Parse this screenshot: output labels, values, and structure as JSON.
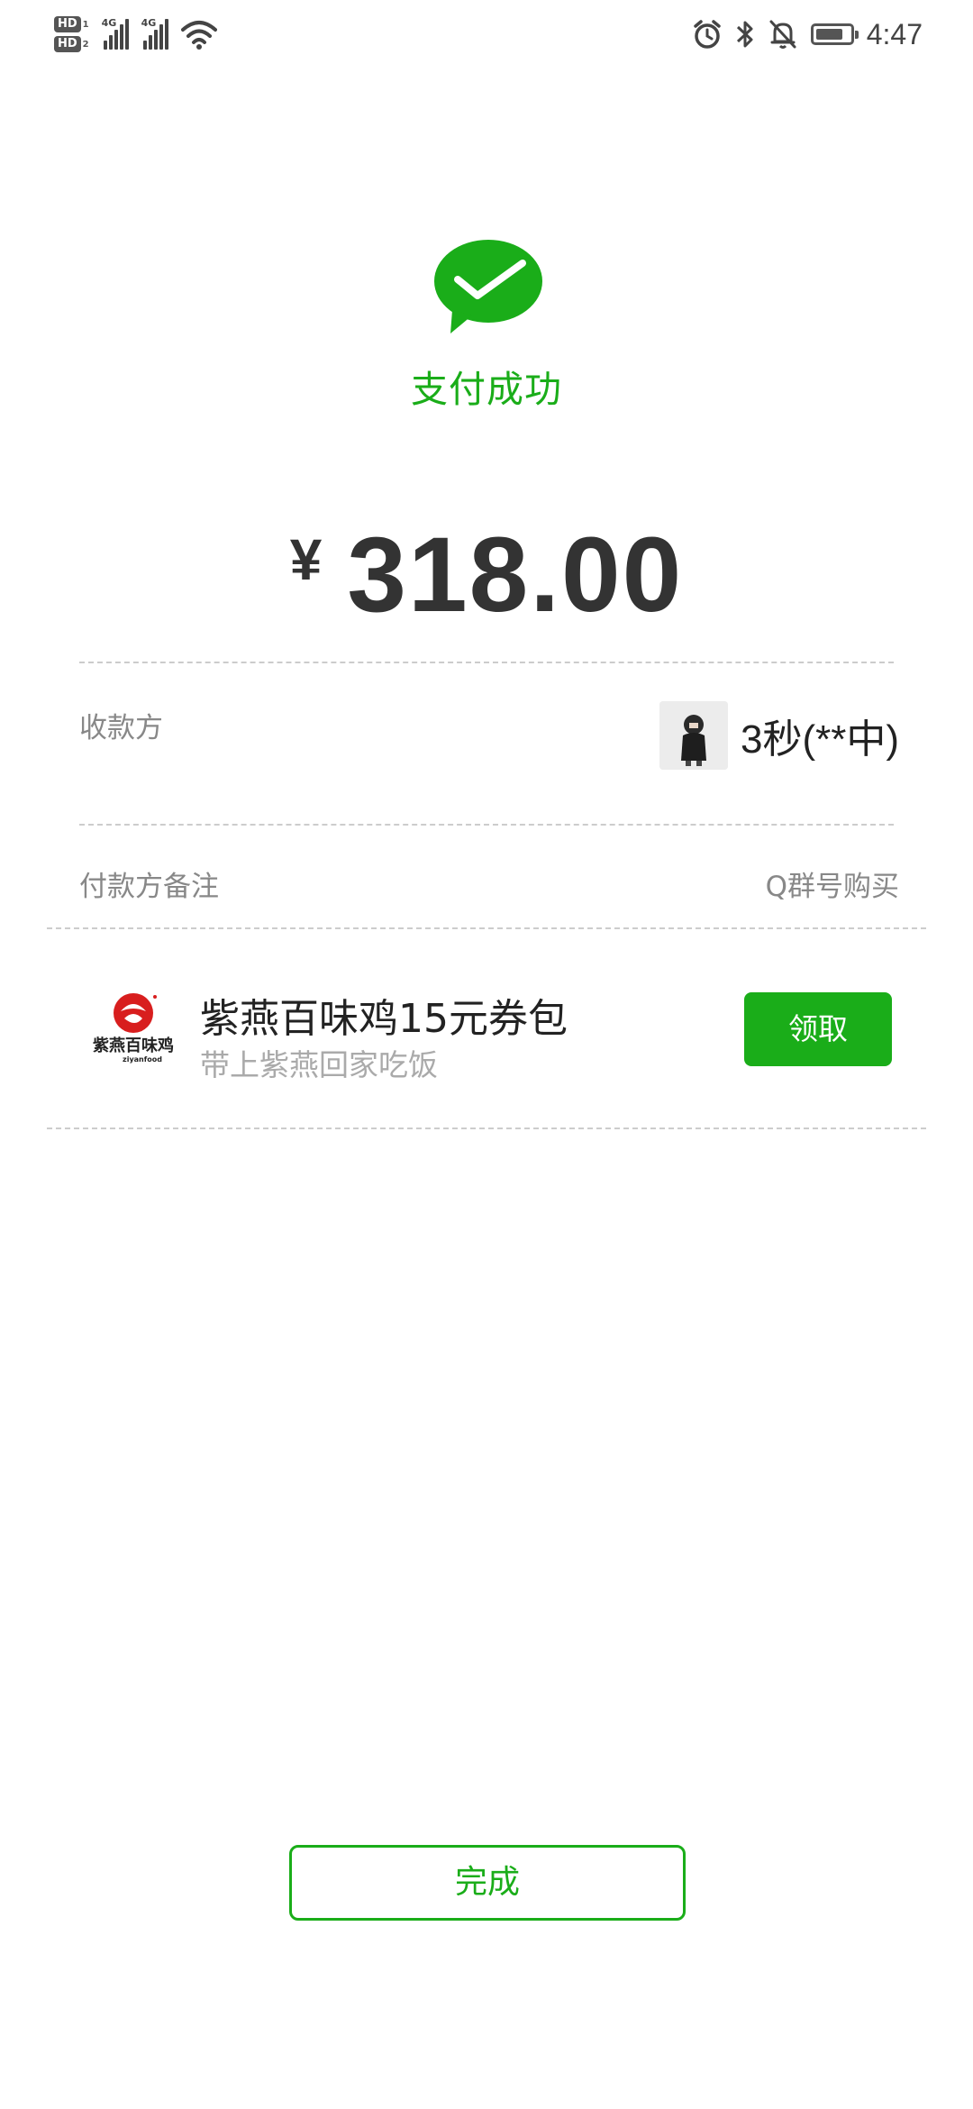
{
  "status_bar": {
    "sim1_badge": "HD",
    "sim1_index": "1",
    "sim2_badge": "HD",
    "sim2_index": "2",
    "network1": "4G",
    "network2": "4G",
    "time": "4:47",
    "icons": [
      "alarm-icon",
      "bluetooth-icon",
      "bell-off-icon",
      "battery-icon"
    ],
    "battery_level": 0.8
  },
  "header": {
    "status": "支付成功",
    "brand_color": "#1aad19"
  },
  "payment": {
    "currency": "¥",
    "amount": "318.00"
  },
  "details": {
    "payee_label": "收款方",
    "payee_name": "3秒(**中)",
    "note_label": "付款方备注",
    "note_value": "Q群号购买"
  },
  "promo": {
    "logo_text": "紫燕百味鸡",
    "logo_subtext": "ziyanfood",
    "title": "紫燕百味鸡15元券包",
    "subtitle": "带上紫燕回家吃饭",
    "button": "领取"
  },
  "footer": {
    "done_button": "完成"
  }
}
